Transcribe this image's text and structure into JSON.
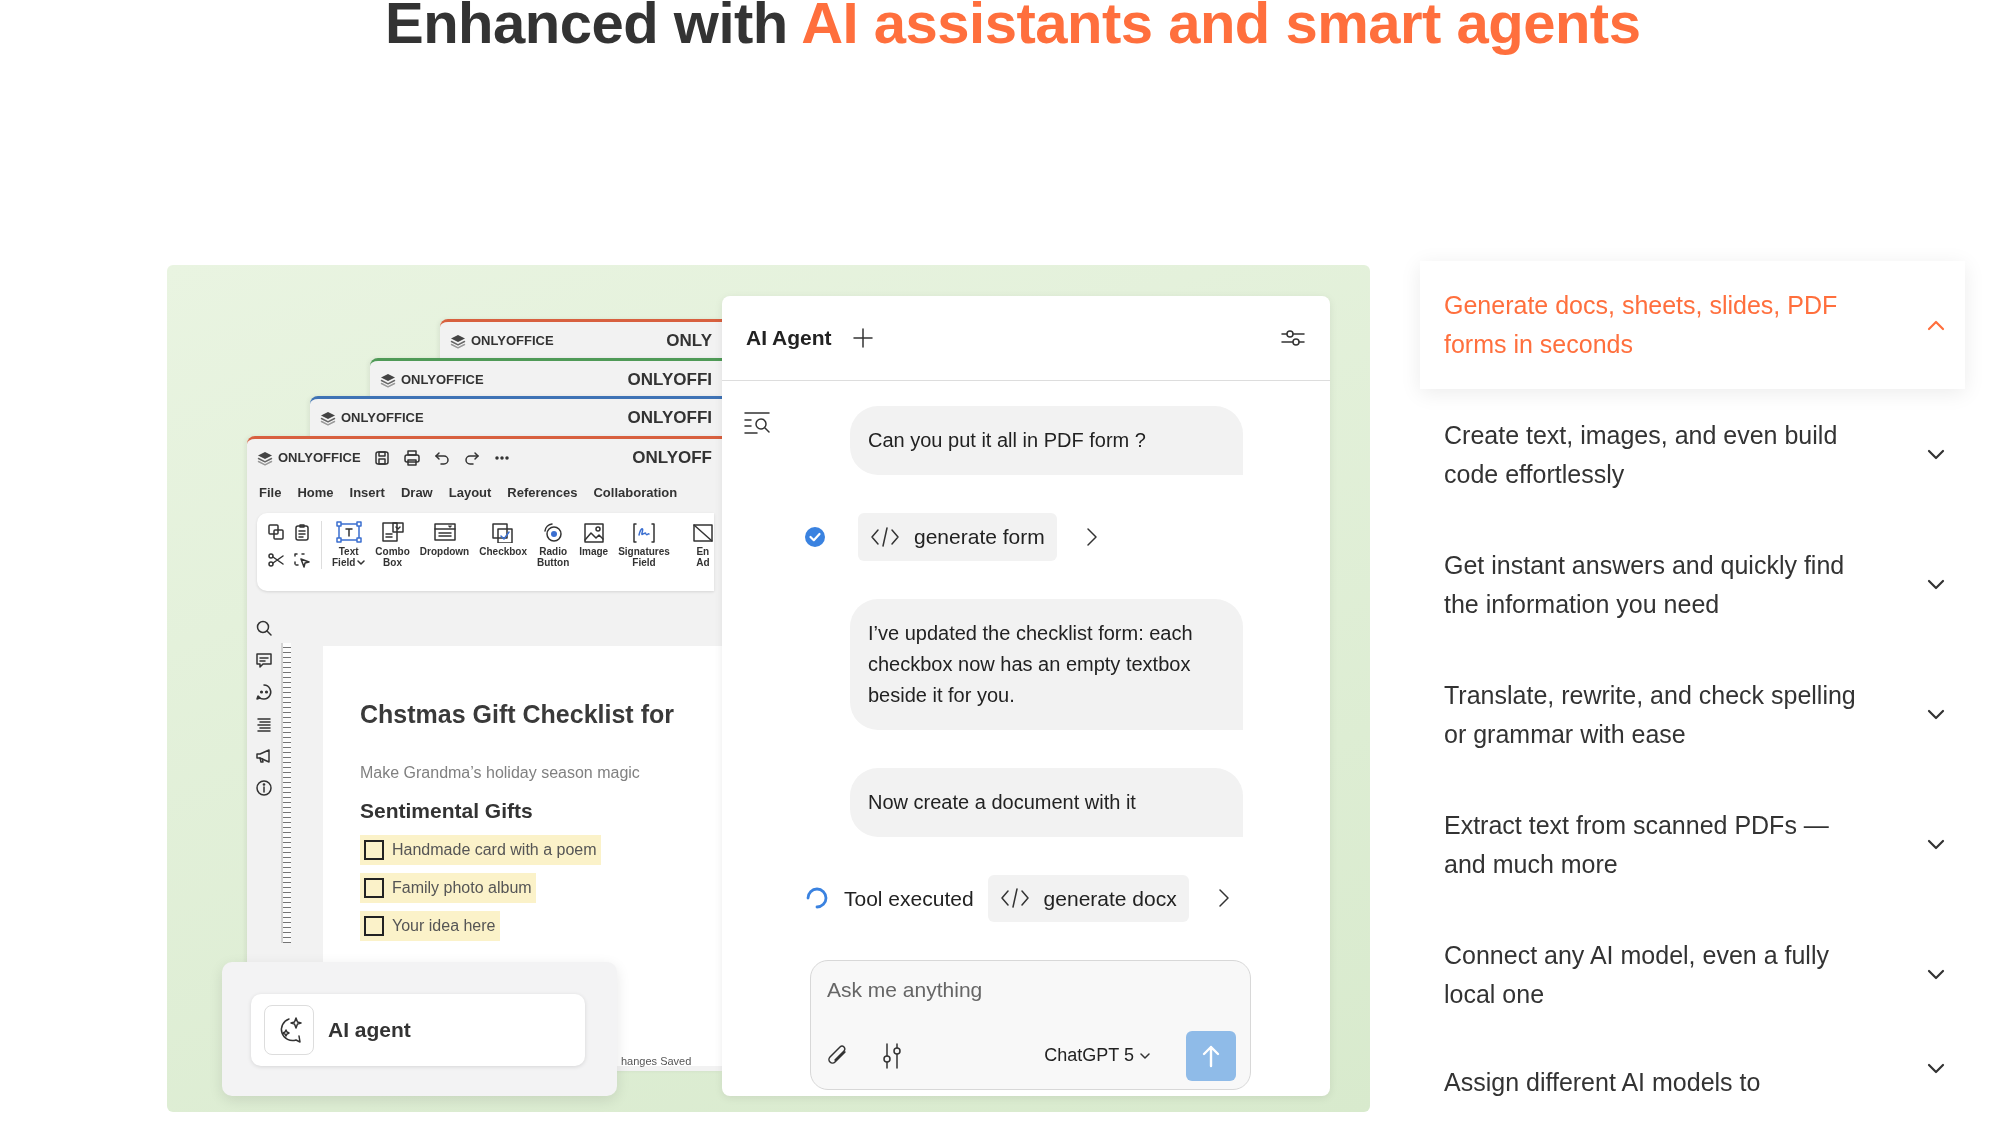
{
  "heading": {
    "text": "Enhanced with ",
    "highlight": "AI assistants and smart agents"
  },
  "editor_windows": [
    {
      "logo": "ONLYOFFICE",
      "title": "ONLY",
      "color": "#d8603f"
    },
    {
      "logo": "ONLYOFFICE",
      "title": "ONLYOFFI",
      "color": "#4f9a57"
    },
    {
      "logo": "ONLYOFFICE",
      "title": "ONLYOFFI",
      "color": "#3f73b5"
    }
  ],
  "editor": {
    "logo": "ONLYOFFICE",
    "title": "ONLYOFF",
    "color": "#d8603f",
    "menu": [
      "File",
      "Home",
      "Insert",
      "Draw",
      "Layout",
      "References",
      "Collaboration"
    ],
    "tools": [
      {
        "lines": [
          "Text",
          "Field"
        ],
        "caret": true
      },
      {
        "lines": [
          "Combo",
          "Box"
        ],
        "caret": false
      },
      {
        "lines": [
          "Dropdown"
        ],
        "caret": false
      },
      {
        "lines": [
          "Checkbox"
        ],
        "caret": false
      },
      {
        "lines": [
          "Radio",
          "Button"
        ],
        "caret": false
      },
      {
        "lines": [
          "Image"
        ],
        "caret": false
      },
      {
        "lines": [
          "Signatures",
          "Field"
        ],
        "caret": false
      },
      {
        "lines": [
          "En",
          "Ad"
        ],
        "caret": false
      }
    ],
    "document": {
      "title": "Chstmas Gift Checklist for",
      "subtitle": "Make Grandma’s holiday season magic",
      "section": "Sentimental Gifts",
      "items": [
        {
          "label": "Handmade card with a poem",
          "checked": false
        },
        {
          "label": "Family photo album",
          "checked": false
        },
        {
          "label": "Your idea here",
          "checked": false
        }
      ]
    },
    "status": "hanges Saved"
  },
  "ai_card": {
    "label": "AI agent"
  },
  "agent": {
    "title": "AI Agent",
    "messages": [
      {
        "kind": "bubble",
        "text": "Can you put it all in PDF form ?"
      },
      {
        "kind": "tool",
        "running": false,
        "name": "generate form"
      },
      {
        "kind": "bubble",
        "text": "I’ve updated the checklist form: each checkbox now has an empty textbox beside it for you."
      },
      {
        "kind": "bubble",
        "text": "Now create a document with it"
      },
      {
        "kind": "tool",
        "running": true,
        "label": "Tool executed",
        "name": "generate docx"
      }
    ],
    "input": {
      "placeholder": "Ask me anything",
      "model": "ChatGPT 5"
    }
  },
  "features": [
    {
      "text": "Generate docs, sheets, slides, PDF forms in seconds",
      "expanded": true
    },
    {
      "text": "Create text, images, and even build code effortlessly",
      "expanded": false
    },
    {
      "text": "Get instant answers and quickly find the information you need",
      "expanded": false
    },
    {
      "text": "Translate, rewrite, and check spelling or grammar with ease",
      "expanded": false
    },
    {
      "text": "Extract text from scanned PDFs — and much more",
      "expanded": false
    },
    {
      "text": "Connect any AI model, even a fully local one",
      "expanded": false
    },
    {
      "text": "Assign different AI models to",
      "expanded": false
    }
  ]
}
